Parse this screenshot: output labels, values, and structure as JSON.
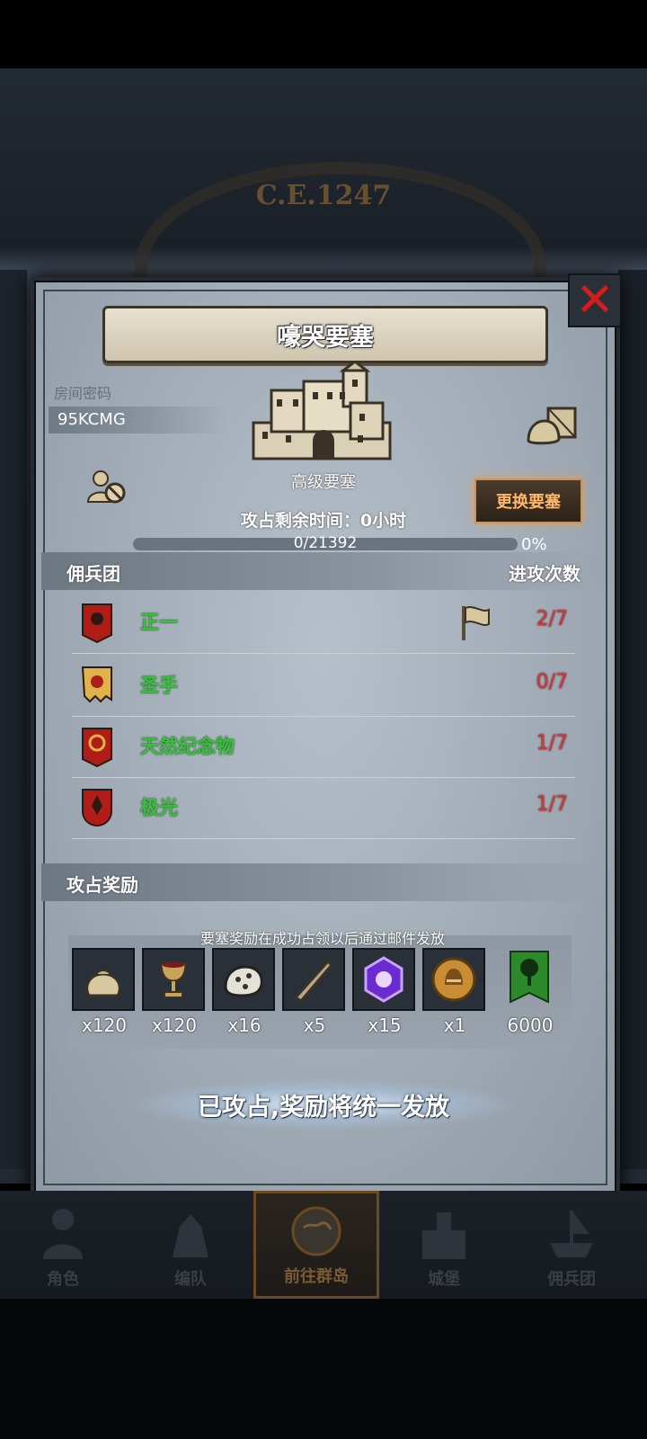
{
  "header": {
    "era": "C.E.1247"
  },
  "panel": {
    "title": "嚎哭要塞",
    "room_code_label": "房间密码",
    "room_code": "95KCMG",
    "fortress_name": "高级要塞",
    "change_button": "更换要塞",
    "timer_text": "攻占剩余时间：0小时",
    "progress": {
      "text": "0/21392",
      "percent_text": "0%",
      "fraction": 0
    },
    "mercenary": {
      "header": "佣兵团",
      "attacks_header": "进攻次数",
      "rows": [
        {
          "name": "正一",
          "count": "2/7",
          "flag": true
        },
        {
          "name": "圣手",
          "count": "0/7",
          "flag": false
        },
        {
          "name": "天然纪念物",
          "count": "1/7",
          "flag": false
        },
        {
          "name": "极光",
          "count": "1/7",
          "flag": false
        }
      ]
    },
    "rewards": {
      "header": "攻占奖励",
      "note": "要塞奖励在成功占领以后通过邮件发放",
      "items": [
        {
          "icon": "sack-icon",
          "qty": "x120"
        },
        {
          "icon": "goblet-icon",
          "qty": "x120"
        },
        {
          "icon": "ore-icon",
          "qty": "x16"
        },
        {
          "icon": "horn-icon",
          "qty": "x5"
        },
        {
          "icon": "purple-gem-icon",
          "qty": "x15"
        },
        {
          "icon": "helmet-medal-icon",
          "qty": "x1"
        },
        {
          "icon": "tree-banner-icon",
          "qty": "6000"
        }
      ]
    },
    "claim_text": "已攻占,奖励将统一发放"
  },
  "nav": {
    "items": [
      {
        "label": "角色"
      },
      {
        "label": "编队"
      },
      {
        "label": "前往群岛"
      },
      {
        "label": "城堡"
      },
      {
        "label": "佣兵团"
      }
    ]
  }
}
